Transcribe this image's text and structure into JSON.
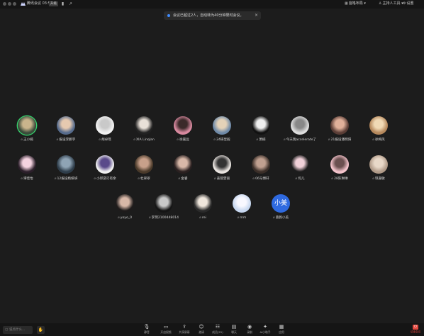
{
  "topbar": {
    "meeting_time": "腾讯会议 03:50",
    "badge": "升级",
    "right": {
      "layout": "宫格布局",
      "assistant": "主持人工具",
      "settings": "设置"
    }
  },
  "notice": {
    "text": "会议已超过2人，自动转为40分钟限时会议。",
    "close": "×"
  },
  "participants": [
    {
      "name": "王小楠"
    },
    {
      "name": "报设李鹏宇"
    },
    {
      "name": "胡卓瑶"
    },
    {
      "name": "XIA Linqian"
    },
    {
      "name": "徐嘉远"
    },
    {
      "name": "24研皇毅"
    },
    {
      "name": "萧楠"
    },
    {
      "name": "今天我accelerate了"
    },
    {
      "name": "21报设潘明阳"
    },
    {
      "name": "徐梅凤"
    },
    {
      "name": "谭佳怡"
    },
    {
      "name": "12报设杨妍妍"
    },
    {
      "name": "小邱游刃有余"
    },
    {
      "name": "杜翠翠"
    },
    {
      "name": "金睿"
    },
    {
      "name": "姜蓉雯丽"
    },
    {
      "name": "06马博轩"
    },
    {
      "name": "何儿"
    },
    {
      "name": "28陈琳琳"
    },
    {
      "name": "琪嘉敏"
    },
    {
      "name": "yoyo_0"
    },
    {
      "name": "李玥2100448014"
    },
    {
      "name": "rei"
    },
    {
      "name": "mm"
    },
    {
      "name": "蔷薇小美",
      "avatar_text": "小美"
    }
  ],
  "toolbar": {
    "chat_placeholder": "说点什么...",
    "buttons": [
      {
        "label": "静音",
        "icon": "microphone-icon"
      },
      {
        "label": "开启视频",
        "icon": "camera-icon"
      },
      {
        "label": "共享屏幕",
        "icon": "share-screen-icon"
      },
      {
        "label": "邀请",
        "icon": "invite-icon"
      },
      {
        "label": "成员(25)",
        "icon": "members-icon"
      },
      {
        "label": "聊天",
        "icon": "chat-icon"
      },
      {
        "label": "录制",
        "icon": "record-icon"
      },
      {
        "label": "AI小助手",
        "icon": "ai-assistant-icon"
      },
      {
        "label": "应用",
        "icon": "apps-icon"
      }
    ],
    "leave_label": "结束会议"
  }
}
